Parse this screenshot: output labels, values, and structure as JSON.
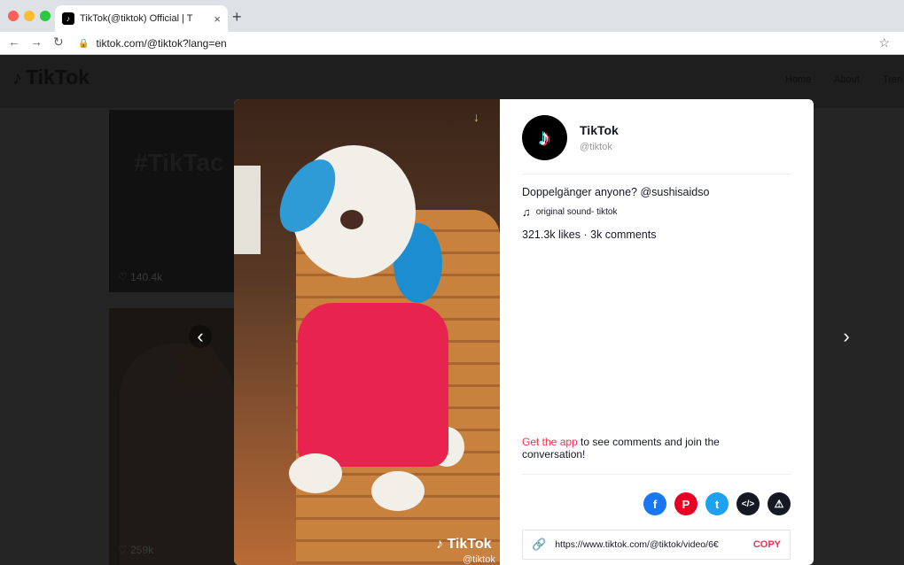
{
  "browser": {
    "tab_title": "TikTok(@tiktok) Official | T",
    "tab_favicon": "♪",
    "tab_close": "×",
    "new_tab": "+",
    "back": "←",
    "forward": "→",
    "reload": "↻",
    "lock": "🔒",
    "url": "tiktok.com/@tiktok?lang=en",
    "star": "☆"
  },
  "site": {
    "logo_text": "TikTok",
    "logo_icon": "♪",
    "nav": [
      "Home",
      "About",
      "Tren"
    ]
  },
  "background": {
    "hashtag": "#TikTac",
    "likes_1": "♡ 140.4k",
    "likes_2": "♡ 259k"
  },
  "video": {
    "download_icon": "↓",
    "watermark": "♪ TikTok",
    "watermark_handle": "@tiktok"
  },
  "post": {
    "avatar_icon": "♪",
    "name": "TikTok",
    "handle": "@tiktok",
    "caption": "Doppelgänger anyone? @sushisaidso",
    "music_icon": "♫",
    "music": "original sound- tiktok",
    "stats": "321.3k likes · 3k comments",
    "cta_link": "Get the app",
    "cta_rest": " to see comments and join the conversation!",
    "share": {
      "facebook": "f",
      "pinterest": "P",
      "twitter": "t",
      "embed": "</>",
      "report": "⚠"
    },
    "link_icon": "🔗",
    "link_url": "https://www.tiktok.com/@tiktok/video/6€",
    "copy_label": "COPY"
  },
  "nav_arrows": {
    "prev": "‹",
    "next": "›"
  }
}
